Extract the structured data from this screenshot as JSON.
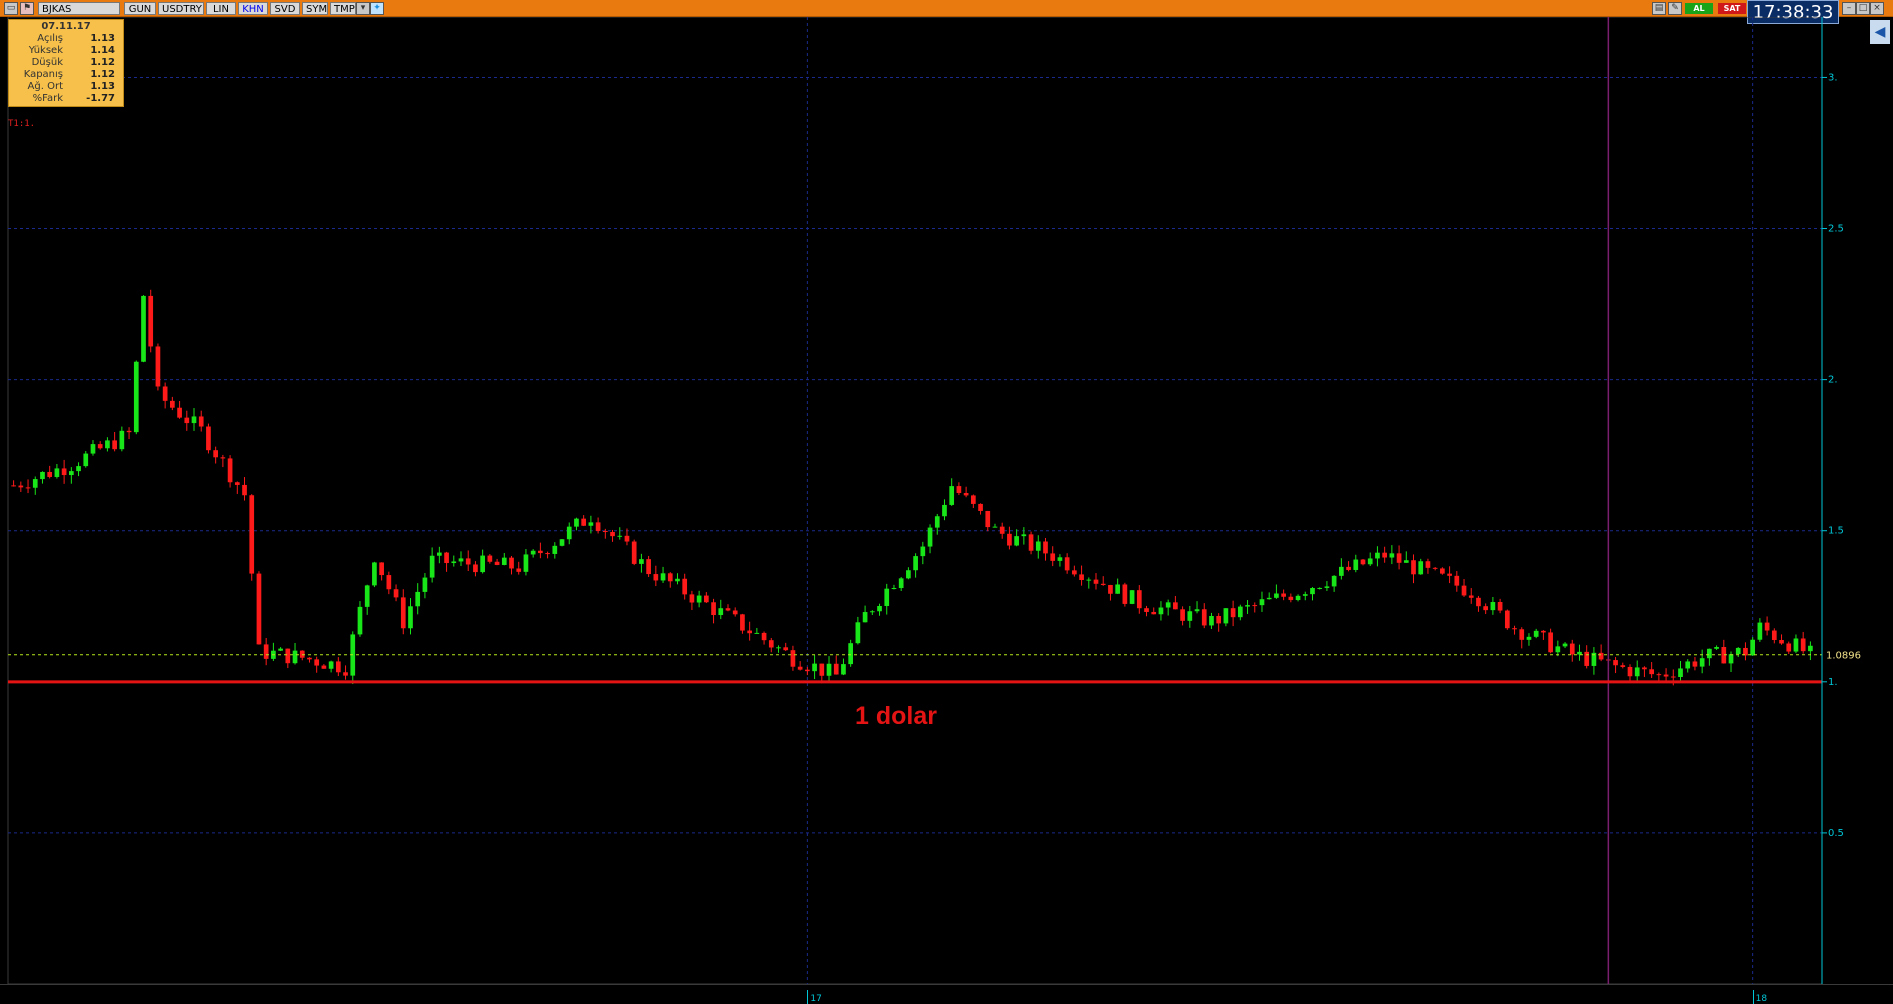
{
  "toolbar": {
    "symbol": "BJKAS",
    "buttons": [
      "GUN",
      "USDTRY",
      "LIN",
      "KHN",
      "SVD",
      "SYM",
      "TMP"
    ],
    "active_button": "KHN",
    "buy_label": "AL",
    "sell_label": "SAT"
  },
  "clock": "17:38:33",
  "ohlc_panel": {
    "date": "07.11.17",
    "rows": [
      {
        "label": "Açılış",
        "value": "1.13"
      },
      {
        "label": "Yüksek",
        "value": "1.14"
      },
      {
        "label": "Düşük",
        "value": "1.12"
      },
      {
        "label": "Kapanış",
        "value": "1.12"
      },
      {
        "label": "Ağ. Ort",
        "value": "1.13"
      },
      {
        "label": "%Fark",
        "value": "-1.77"
      }
    ]
  },
  "overlay_label": "T1:1.",
  "annotation": "1 dolar",
  "colors": {
    "up": "#19e619",
    "down": "#ff1a1a",
    "grid": "#1a2a8c",
    "axis_text": "#00c7d8",
    "last_price_line": "#b5e61a",
    "support_line": "#e51414",
    "cursor_line": "#7a1f6e"
  },
  "chart_data": {
    "type": "candlestick",
    "title": "",
    "xlabel": "",
    "ylabel": "",
    "ylim": [
      0.0,
      3.2
    ],
    "y_ticks": [
      {
        "value": 3.0,
        "label": "3."
      },
      {
        "value": 2.5,
        "label": "2.5"
      },
      {
        "value": 2.0,
        "label": "2."
      },
      {
        "value": 1.5,
        "label": "1.5"
      },
      {
        "value": 1.0,
        "label": "1."
      },
      {
        "value": 0.5,
        "label": "0.5"
      }
    ],
    "x_ticks": [
      {
        "index": 110,
        "label": "17"
      },
      {
        "index": 241,
        "label": "18"
      }
    ],
    "last_price": {
      "value": 1.0896,
      "label": "1.0896"
    },
    "support_level": 1.0,
    "cursor_index": 221,
    "n_candles": 250,
    "close_path": [
      [
        0,
        1.65
      ],
      [
        8,
        1.72
      ],
      [
        16,
        1.82
      ],
      [
        18,
        2.28
      ],
      [
        20,
        1.95
      ],
      [
        26,
        1.83
      ],
      [
        32,
        1.62
      ],
      [
        34,
        1.1
      ],
      [
        40,
        1.08
      ],
      [
        46,
        1.05
      ],
      [
        50,
        1.42
      ],
      [
        54,
        1.2
      ],
      [
        58,
        1.4
      ],
      [
        70,
        1.38
      ],
      [
        80,
        1.55
      ],
      [
        88,
        1.37
      ],
      [
        100,
        1.2
      ],
      [
        108,
        1.08
      ],
      [
        114,
        1.02
      ],
      [
        118,
        1.22
      ],
      [
        126,
        1.45
      ],
      [
        130,
        1.65
      ],
      [
        136,
        1.5
      ],
      [
        144,
        1.42
      ],
      [
        156,
        1.26
      ],
      [
        166,
        1.2
      ],
      [
        178,
        1.3
      ],
      [
        190,
        1.42
      ],
      [
        202,
        1.3
      ],
      [
        208,
        1.18
      ],
      [
        216,
        1.09
      ],
      [
        222,
        1.05
      ],
      [
        228,
        1.02
      ],
      [
        234,
        1.08
      ],
      [
        240,
        1.1
      ],
      [
        242,
        1.18
      ],
      [
        249,
        1.09
      ]
    ]
  }
}
